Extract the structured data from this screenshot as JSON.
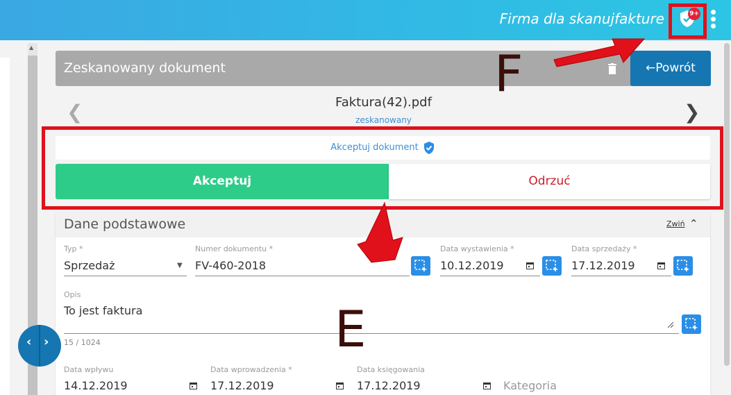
{
  "topbar": {
    "company": "Firma dla skanujfakture",
    "badge": "9+"
  },
  "header": {
    "title": "Zeskanowany dokument",
    "back_label": "←Powrót"
  },
  "file": {
    "name": "Faktura(42).pdf",
    "status": "zeskanowany"
  },
  "acceptance": {
    "info": "Akceptuj dokument",
    "accept_label": "Akceptuj",
    "reject_label": "Odrzuć"
  },
  "section": {
    "title": "Dane podstawowe",
    "collapse_label": "Zwiń"
  },
  "fields": {
    "typ": {
      "label": "Typ *",
      "value": "Sprzedaż"
    },
    "numer": {
      "label": "Numer dokumentu *",
      "value": "FV-460-2018"
    },
    "data_wystawienia": {
      "label": "Data wystawienia *",
      "value": "10.12.2019"
    },
    "data_sprzedazy": {
      "label": "Data sprzedaży *",
      "value": "17.12.2019"
    },
    "opis": {
      "label": "Opis",
      "value": "To jest faktura",
      "counter": "15 / 1024"
    },
    "data_wplywu": {
      "label": "Data wpływu",
      "value": "14.12.2019"
    },
    "data_wprowadzenia": {
      "label": "Data wprowadzenia *",
      "value": "17.12.2019"
    },
    "data_ksiegowania": {
      "label": "Data księgowania",
      "value": "17.12.2019"
    },
    "kategoria": {
      "placeholder": "Kategoria"
    }
  },
  "annotations": {
    "f": "F",
    "e": "E"
  },
  "colors": {
    "accent": "#1576b2",
    "accept": "#2ecc89",
    "reject": "#c81d2b",
    "highlight": "#e0111b"
  }
}
